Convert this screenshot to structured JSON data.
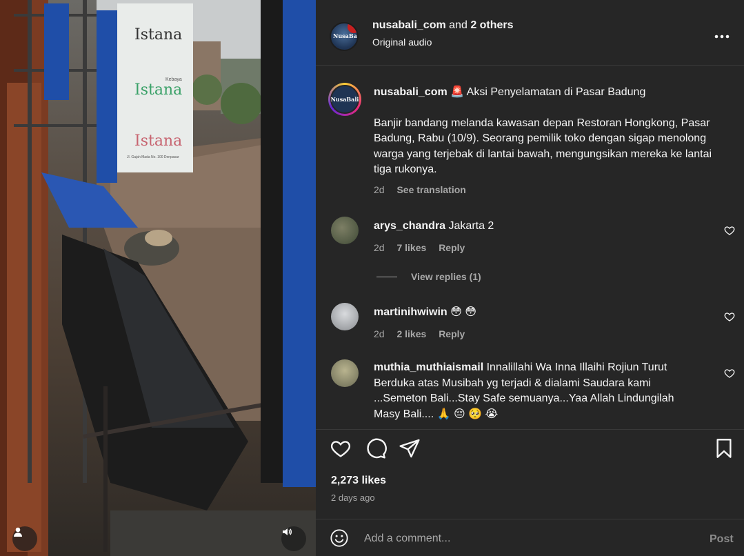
{
  "media": {
    "signs": [
      "Istana",
      "Istana",
      "Istana"
    ],
    "sign_small": "Kebaya",
    "sign_address": "Jl. Gajah Mada No. 100 Denpasar",
    "user_icon": "user-icon",
    "audio_icon": "speaker-icon"
  },
  "header": {
    "username": "nusabali_com",
    "joiner": "and",
    "others": "2 others",
    "audio": "Original audio",
    "more_icon": "more-icon",
    "avatar_text": "NusaBali"
  },
  "caption": {
    "username": "nusabali_com",
    "title": "🚨 Aksi Penyelamatan di Pasar Badung",
    "body": "Banjir bandang melanda kawasan depan Restoran Hongkong, Pasar Badung, Rabu (10/9). Seorang pemilik toko dengan sigap menolong warga yang terjebak di lantai bawah, mengungsikan mereka ke lantai tiga rukonya.",
    "time": "2d",
    "see_translation": "See translation"
  },
  "comments": [
    {
      "username": "arys_chandra",
      "text": "Jakarta 2",
      "time": "2d",
      "likes": "7 likes",
      "reply": "Reply"
    },
    {
      "username": "martinihwiwin",
      "text": "😳 😳",
      "time": "2d",
      "likes": "2 likes",
      "reply": "Reply"
    },
    {
      "username": "muthia_muthiaismail",
      "text": "Innalillahi Wa Inna Illaihi Rojiun Turut Berduka atas Musibah yg terjadi & dialami Saudara kami ...Semeton Bali...Stay Safe semuanya...Yaa Allah Lindungilah Masy Bali....",
      "emojis": "🙏 😔 🥺 😭"
    }
  ],
  "view_replies": "View replies (1)",
  "footer": {
    "likes": "2,273 likes",
    "time_ago": "2 days ago",
    "comment_placeholder": "Add a comment...",
    "post_label": "Post"
  },
  "colors": {
    "panel_bg": "#262626",
    "text": "#f5f5f5",
    "muted": "#a8a8a8"
  }
}
